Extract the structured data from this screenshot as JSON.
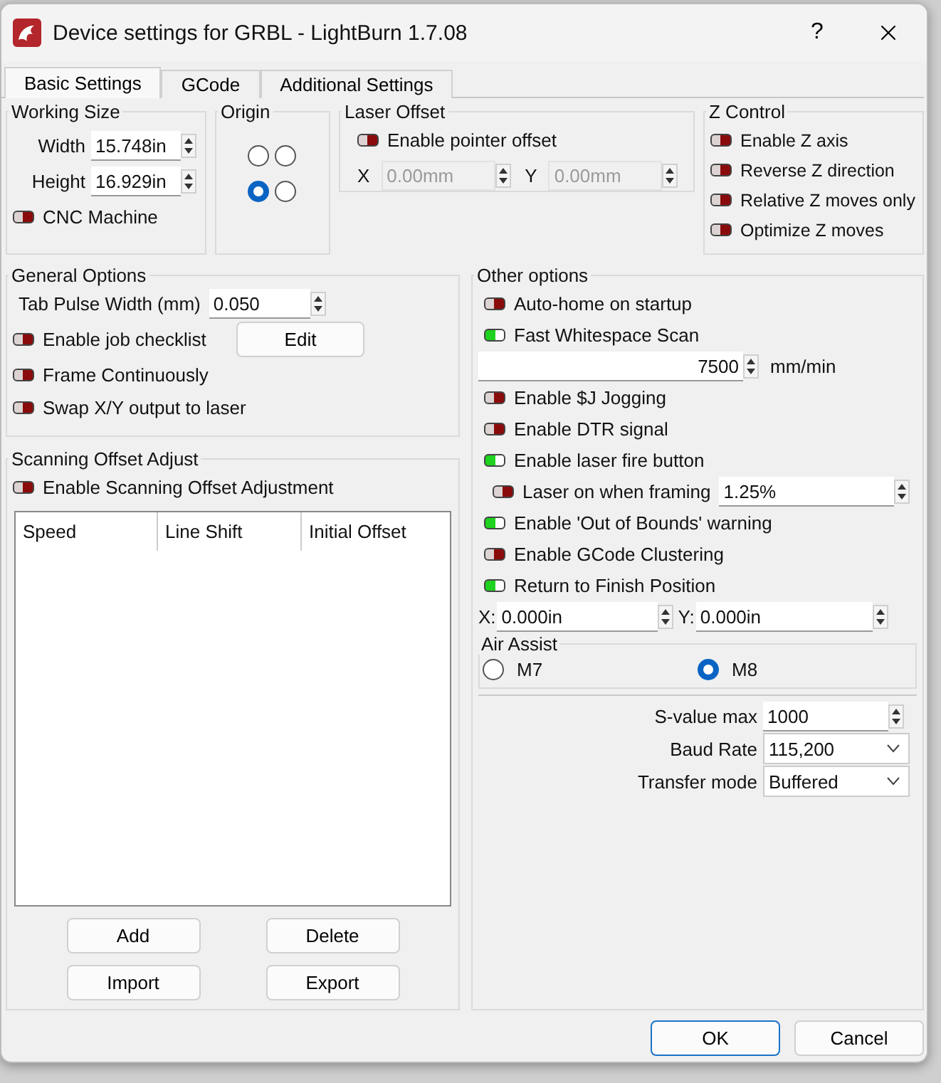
{
  "window": {
    "title": "Device settings for GRBL - LightBurn 1.7.08",
    "help": "?"
  },
  "tabs": [
    {
      "label": "Basic Settings",
      "selected": true
    },
    {
      "label": "GCode",
      "selected": false
    },
    {
      "label": "Additional Settings",
      "selected": false
    }
  ],
  "working_size": {
    "title": "Working Size",
    "width": {
      "label": "Width",
      "value": "15.748in"
    },
    "height": {
      "label": "Height",
      "value": "16.929in"
    },
    "cnc_machine": {
      "label": "CNC Machine",
      "on": false
    }
  },
  "origin": {
    "title": "Origin",
    "corners": [
      {
        "selected": false
      },
      {
        "selected": false
      },
      {
        "selected": true
      },
      {
        "selected": false
      }
    ]
  },
  "laser_offset": {
    "title": "Laser Offset",
    "enable": {
      "label": "Enable pointer offset",
      "on": false
    },
    "x": {
      "label": "X",
      "value": "0.00mm",
      "disabled": true
    },
    "y": {
      "label": "Y",
      "value": "0.00mm",
      "disabled": true
    }
  },
  "z_control": {
    "title": "Z Control",
    "options": [
      {
        "label": "Enable Z axis",
        "on": false
      },
      {
        "label": "Reverse Z direction",
        "on": false
      },
      {
        "label": "Relative Z moves only",
        "on": false
      },
      {
        "label": "Optimize Z moves",
        "on": false
      }
    ]
  },
  "general_options": {
    "title": "General Options",
    "tab_pulse": {
      "label": "Tab Pulse Width (mm)",
      "value": "0.050"
    },
    "toggles": [
      {
        "label": "Enable job checklist",
        "on": false,
        "button": "Edit"
      },
      {
        "label": "Frame Continuously",
        "on": false
      },
      {
        "label": "Swap X/Y output to laser",
        "on": false
      }
    ]
  },
  "scanning": {
    "title": "Scanning Offset Adjust",
    "enable": {
      "label": "Enable Scanning Offset Adjustment",
      "on": false
    },
    "columns": [
      "Speed",
      "Line Shift",
      "Initial Offset"
    ],
    "buttons": [
      "Add",
      "Delete",
      "Import",
      "Export"
    ]
  },
  "other_options": {
    "title": "Other options",
    "items": [
      {
        "kind": "toggle",
        "label": "Auto-home on startup",
        "on": false
      },
      {
        "kind": "toggle",
        "label": "Fast Whitespace Scan",
        "on": true
      },
      {
        "kind": "speed",
        "value": "7500",
        "unit": "mm/min"
      },
      {
        "kind": "toggle",
        "label": "Enable $J Jogging",
        "on": false
      },
      {
        "kind": "toggle",
        "label": "Enable DTR signal",
        "on": false
      },
      {
        "kind": "toggle",
        "label": "Enable laser fire button",
        "on": true
      },
      {
        "kind": "toggle_value",
        "label": "Laser on when framing",
        "on": false,
        "value": "1.25%"
      },
      {
        "kind": "toggle",
        "label": "Enable 'Out of Bounds' warning",
        "on": true
      },
      {
        "kind": "toggle",
        "label": "Enable GCode Clustering",
        "on": false
      },
      {
        "kind": "toggle",
        "label": "Return to Finish Position",
        "on": true
      },
      {
        "kind": "xy",
        "x_label": "X:",
        "x_value": "0.000in",
        "y_label": "Y:",
        "y_value": "0.000in"
      },
      {
        "kind": "radio_group",
        "title": "Air Assist",
        "options": [
          {
            "label": "M7",
            "selected": false
          },
          {
            "label": "M8",
            "selected": true
          }
        ]
      },
      {
        "kind": "spin",
        "label": "S-value max",
        "value": "1000"
      },
      {
        "kind": "select",
        "label": "Baud Rate",
        "value": "115,200"
      },
      {
        "kind": "select",
        "label": "Transfer mode",
        "value": "Buffered"
      }
    ]
  },
  "buttons": [
    {
      "label": "OK",
      "default": true
    },
    {
      "label": "Cancel",
      "default": false
    }
  ]
}
